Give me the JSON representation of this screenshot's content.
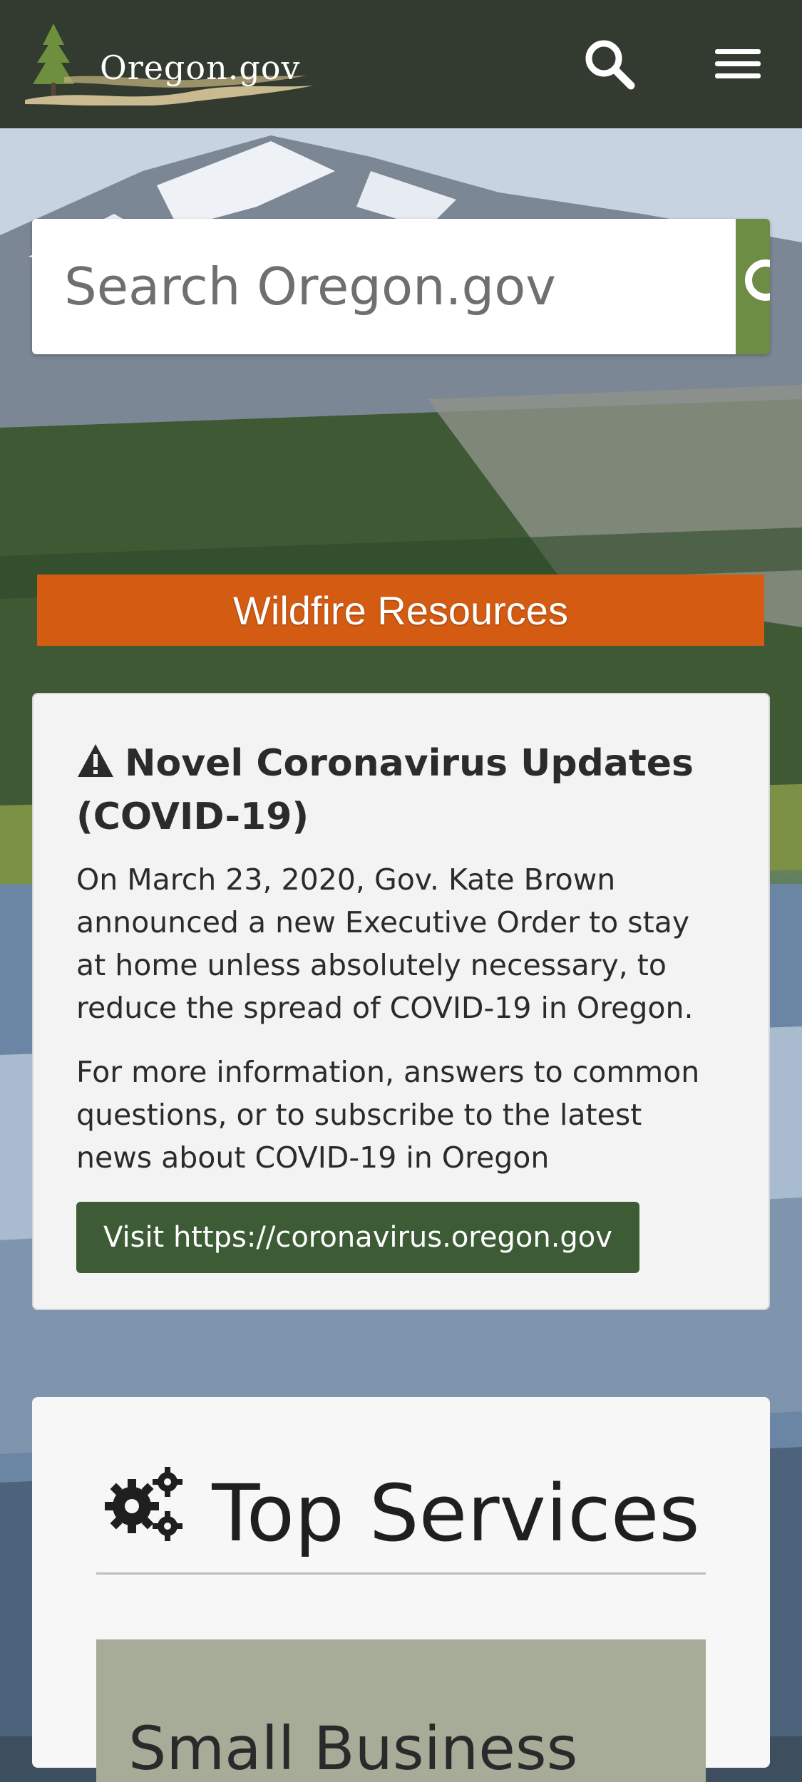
{
  "header": {
    "logo_text": "Oregon.gov",
    "search_icon": "search-icon",
    "menu_icon": "hamburger-menu-icon"
  },
  "search": {
    "placeholder": "Search Oregon.gov",
    "button_icon": "search-icon"
  },
  "wildfire": {
    "label": "Wildfire Resources"
  },
  "covid": {
    "title": "Novel Coronavirus Updates (COVID-19)",
    "icon": "warning-icon",
    "paragraph_1": "On March 23, 2020, Gov. Kate Brown announced a new Executive Order to stay at home unless absolutely necessary, to reduce the spread of COVID-19 in Oregon.",
    "paragraph_2": "For more information, answers to common questions, or to subscribe to the latest news about COVID-19 in Oregon",
    "button_label": "Visit https://coronavirus.oregon.gov"
  },
  "services": {
    "title": "Top Services",
    "icon": "gears-icon",
    "first_tile_label": "Small Business"
  },
  "colors": {
    "header_bg": "#333b31",
    "search_button": "#6d8c44",
    "wildfire_banner": "#d35b12",
    "visit_button": "#3d5c36"
  }
}
